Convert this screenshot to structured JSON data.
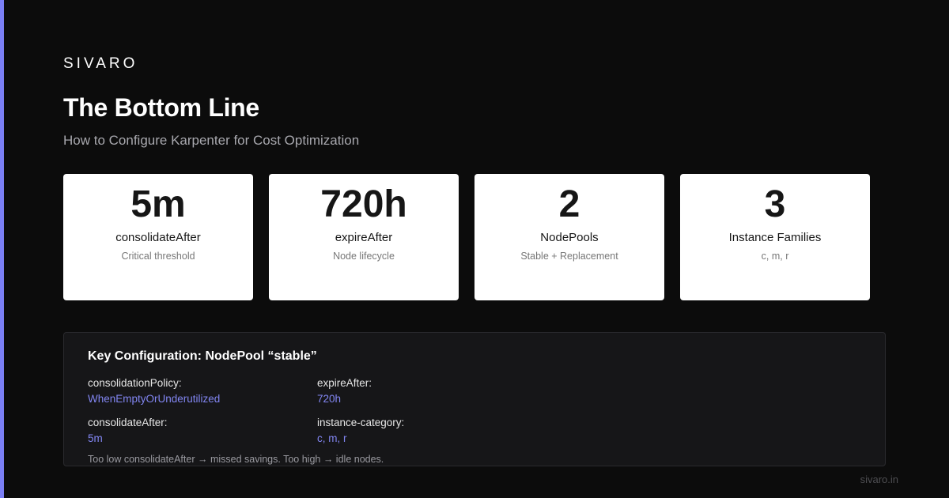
{
  "brand": "SIVARO",
  "title": "The Bottom Line",
  "subtitle": "How to Configure Karpenter for Cost Optimization",
  "accent_color": "#7b7ff5",
  "stats": [
    {
      "value": "5m",
      "label": "consolidateAfter",
      "sub": "Critical threshold"
    },
    {
      "value": "720h",
      "label": "expireAfter",
      "sub": "Node lifecycle"
    },
    {
      "value": "2",
      "label": "NodePools",
      "sub": "Stable + Replacement"
    },
    {
      "value": "3",
      "label": "Instance Families",
      "sub": "c, m, r"
    }
  ],
  "config": {
    "title": "Key Configuration: NodePool “stable”",
    "items": [
      {
        "key": "consolidationPolicy:",
        "value": "WhenEmptyOrUnderutilized"
      },
      {
        "key": "expireAfter:",
        "value": "720h"
      },
      {
        "key": "consolidateAfter:",
        "value": "5m"
      },
      {
        "key": "instance-category:",
        "value": "c, m, r"
      }
    ],
    "note": "Too low consolidateAfter → missed savings. Too high → idle nodes."
  },
  "footer": "sivaro.in"
}
